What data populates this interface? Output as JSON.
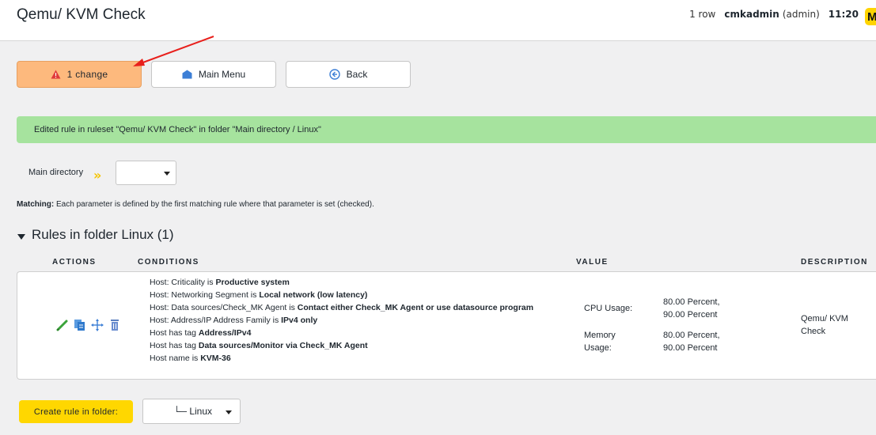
{
  "header": {
    "title": "Qemu/ KVM Check",
    "rows": "1 row",
    "user": "cmkadmin",
    "role": "(admin)",
    "time": "11:20",
    "logo": "M"
  },
  "toolbar": {
    "changes_label": "1 change",
    "main_menu_label": "Main Menu",
    "back_label": "Back"
  },
  "message": "Edited rule in ruleset \"Qemu/ KVM Check\" in folder \"Main directory / Linux\"",
  "folder_nav": {
    "label": "Main directory",
    "selected": ""
  },
  "matching": {
    "label": "Matching:",
    "text": " Each parameter is defined by the first matching rule where that parameter is set (checked)."
  },
  "rules_section": {
    "title": "Rules in folder Linux (1)",
    "columns": {
      "actions": "ACTIONS",
      "conditions": "CONDITIONS",
      "value": "VALUE",
      "description": "DESCRIPTION"
    }
  },
  "rule": {
    "conditions": [
      {
        "prefix": "Host: Criticality is ",
        "value": "Productive system"
      },
      {
        "prefix": "Host: Networking Segment is ",
        "value": "Local network (low latency)"
      },
      {
        "prefix": "Host: Data sources/Check_MK Agent is ",
        "value": "Contact either Check_MK Agent or use datasource program"
      },
      {
        "prefix": "Host: Address/IP Address Family is ",
        "value": "IPv4 only"
      },
      {
        "prefix": "Host has tag ",
        "value": "Address/IPv4"
      },
      {
        "prefix": "Host has tag ",
        "value": "Data sources/Monitor via Check_MK Agent"
      },
      {
        "prefix": "Host name is ",
        "value": "KVM-36"
      }
    ],
    "value": {
      "cpu_label": "CPU Usage:",
      "cpu_v1": "80.00 Percent,",
      "cpu_v2": "90.00 Percent",
      "mem_label1": "Memory",
      "mem_label2": "Usage:",
      "mem_v1": "80.00 Percent,",
      "mem_v2": "90.00 Percent"
    },
    "description1": "Qemu/ KVM",
    "description2": "Check",
    "icons": [
      "edit-icon",
      "clone-icon",
      "move-icon",
      "delete-icon"
    ]
  },
  "create": {
    "button_label": "Create rule in folder:",
    "folder": "└─ Linux"
  },
  "colors": {
    "changes_bg": "#fdb97d",
    "success_bg": "#a6e39e",
    "create_bg": "#ffd700",
    "accent_yellow": "#f5c400"
  }
}
